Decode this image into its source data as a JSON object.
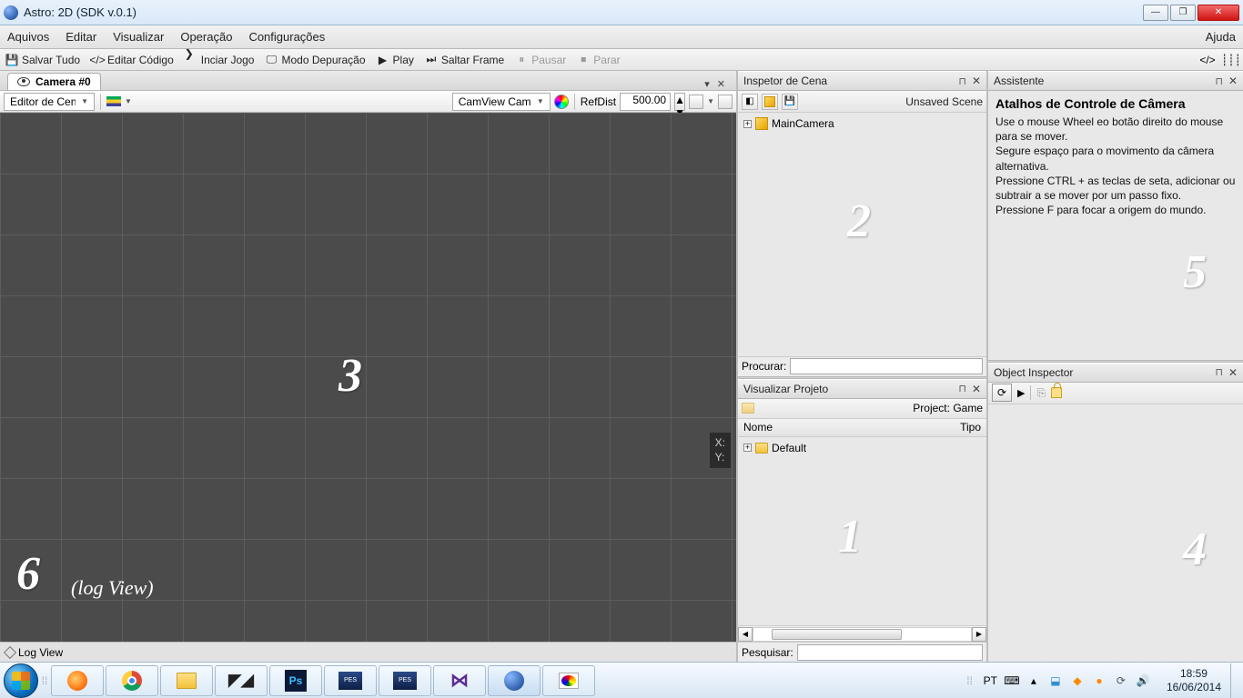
{
  "window": {
    "title": "Astro: 2D (SDK v.0.1)"
  },
  "menu": {
    "arquivos": "Aquivos",
    "editar": "Editar",
    "visualizar": "Visualizar",
    "operacao": "Operação",
    "config": "Configurações",
    "ajuda": "Ajuda"
  },
  "toolbar": {
    "salvar": "Salvar Tudo",
    "editar_codigo": "Editar Código",
    "iniciar_jogo": "Inciar Jogo",
    "modo_dep": "Modo Depuração",
    "play": "Play",
    "saltar_frame": "Saltar Frame",
    "pausar": "Pausar",
    "parar": "Parar"
  },
  "camera": {
    "tab_label": "Camera #0",
    "editor_dd": "Editor de Cena",
    "camview_dd": "CamView Cam",
    "refdist_label": "RefDist",
    "refdist_value": "500.00",
    "coord_x": "X:",
    "coord_y": "Y:"
  },
  "overlays": {
    "n1": "1",
    "n2": "2",
    "n3": "3",
    "n4": "4",
    "n5": "5",
    "n6": "6",
    "logview_label": "(log View)"
  },
  "log_tab": "Log View",
  "scene_inspector": {
    "title": "Inspetor de Cena",
    "unsaved": "Unsaved Scene",
    "main_camera": "MainCamera",
    "procurar": "Procurar:"
  },
  "project_viewer": {
    "title": "Visualizar Projeto",
    "project_label": "Project: Game",
    "col_nome": "Nome",
    "col_tipo": "Tipo",
    "default_folder": "Default",
    "pesquisar": "Pesquisar:"
  },
  "assistant": {
    "title": "Assistente",
    "heading": "Atalhos de Controle de Câmera",
    "body": "Use o mouse Wheel eo botão direito do mouse para se mover.\nSegure espaço para o movimento da câmera alternativa.\nPressione CTRL + as teclas de seta, adicionar ou subtrair a se mover por um passo fixo.\nPressione F para focar a origem do mundo."
  },
  "obj_inspector": {
    "title": "Object Inspector"
  },
  "taskbar": {
    "lang": "PT",
    "time": "18:59",
    "date": "16/06/2014"
  },
  "colors": {
    "viewport_bg": "#4b4b4b"
  }
}
